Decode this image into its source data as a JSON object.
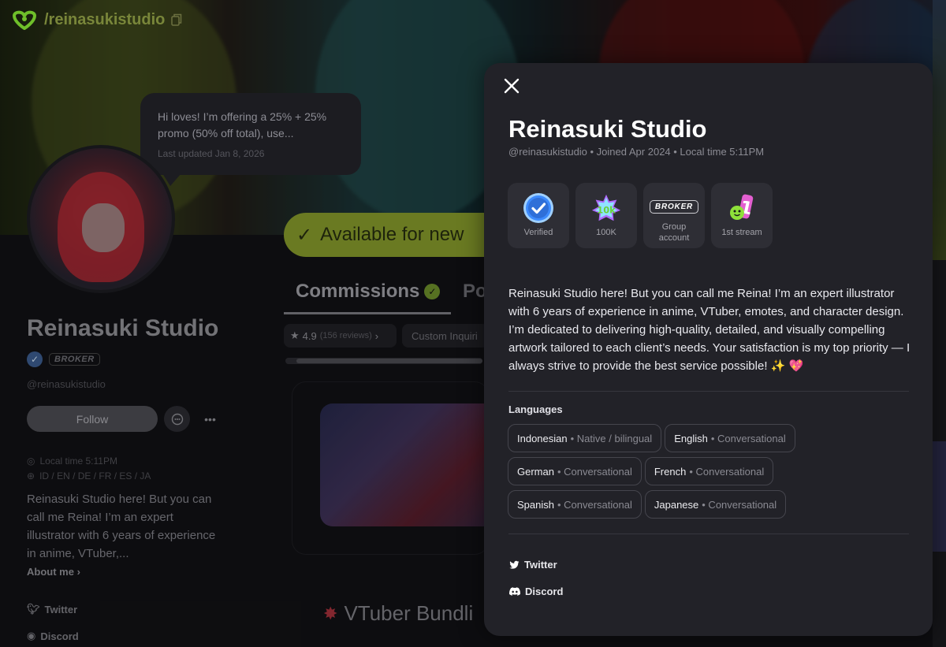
{
  "page": {
    "handle": "/reinasukistudio",
    "speech_bubble": {
      "text": "Hi loves! I’m offering a 25% + 25% promo (50% off total), use...",
      "updated": "Last updated Jan 8, 2026"
    },
    "availability": "Available for new",
    "profile": {
      "name": "Reinasuki Studio",
      "badge": "BROKER",
      "handle": "@reinasukistudio",
      "follow_label": "Follow",
      "local_time": "Local time 5:11PM",
      "languages_short": "ID / EN / DE / FR / ES / JA",
      "bio_excerpt": "Reinasuki Studio here! But you can call me Reina! I’m an expert illustrator with 6 years of experience in anime, VTuber,...",
      "about_label": "About me",
      "twitter": "Twitter",
      "discord": "Discord"
    },
    "tabs": {
      "commissions": "Commissions",
      "portfolio": "Po"
    },
    "rating": {
      "score": "4.9",
      "reviews": "(156 reviews)"
    },
    "filter_chip": "Custom Inquiri",
    "card_title": "VTuber Bundli"
  },
  "panel": {
    "title": "Reinasuki Studio",
    "subtitle": "@reinasukistudio • Joined Apr 2024 • Local time 5:11PM",
    "badges": [
      {
        "icon": "verified-badge-icon",
        "label": "Verified"
      },
      {
        "icon": "100k-badge-icon",
        "label": "100K"
      },
      {
        "icon": "broker-badge-icon",
        "tag": "BROKER",
        "label": "Group account"
      },
      {
        "icon": "first-stream-badge-icon",
        "label": "1st stream"
      }
    ],
    "bio": "Reinasuki Studio here! But you can call me Reina! I’m an expert illustrator with 6 years of experience in anime, VTuber, emotes, and character design. I’m dedicated to delivering high-quality, detailed, and visually compelling artwork tailored to each client’s needs. Your satisfaction is my top priority — I always strive to provide the best service possible! ✨ 💖",
    "languages_heading": "Languages",
    "languages": [
      {
        "name": "Indonesian",
        "level": "• Native / bilingual"
      },
      {
        "name": "English",
        "level": "• Conversational"
      },
      {
        "name": "German",
        "level": "• Conversational"
      },
      {
        "name": "French",
        "level": "• Conversational"
      },
      {
        "name": "Spanish",
        "level": "• Conversational"
      },
      {
        "name": "Japanese",
        "level": "• Conversational"
      }
    ],
    "socials": {
      "twitter": "Twitter",
      "discord": "Discord"
    }
  },
  "colors": {
    "panel_bg": "#222228",
    "badge_bg": "#2e2e35",
    "accent_green": "#6fbf2a",
    "verified_blue": "#3d8bfd"
  }
}
